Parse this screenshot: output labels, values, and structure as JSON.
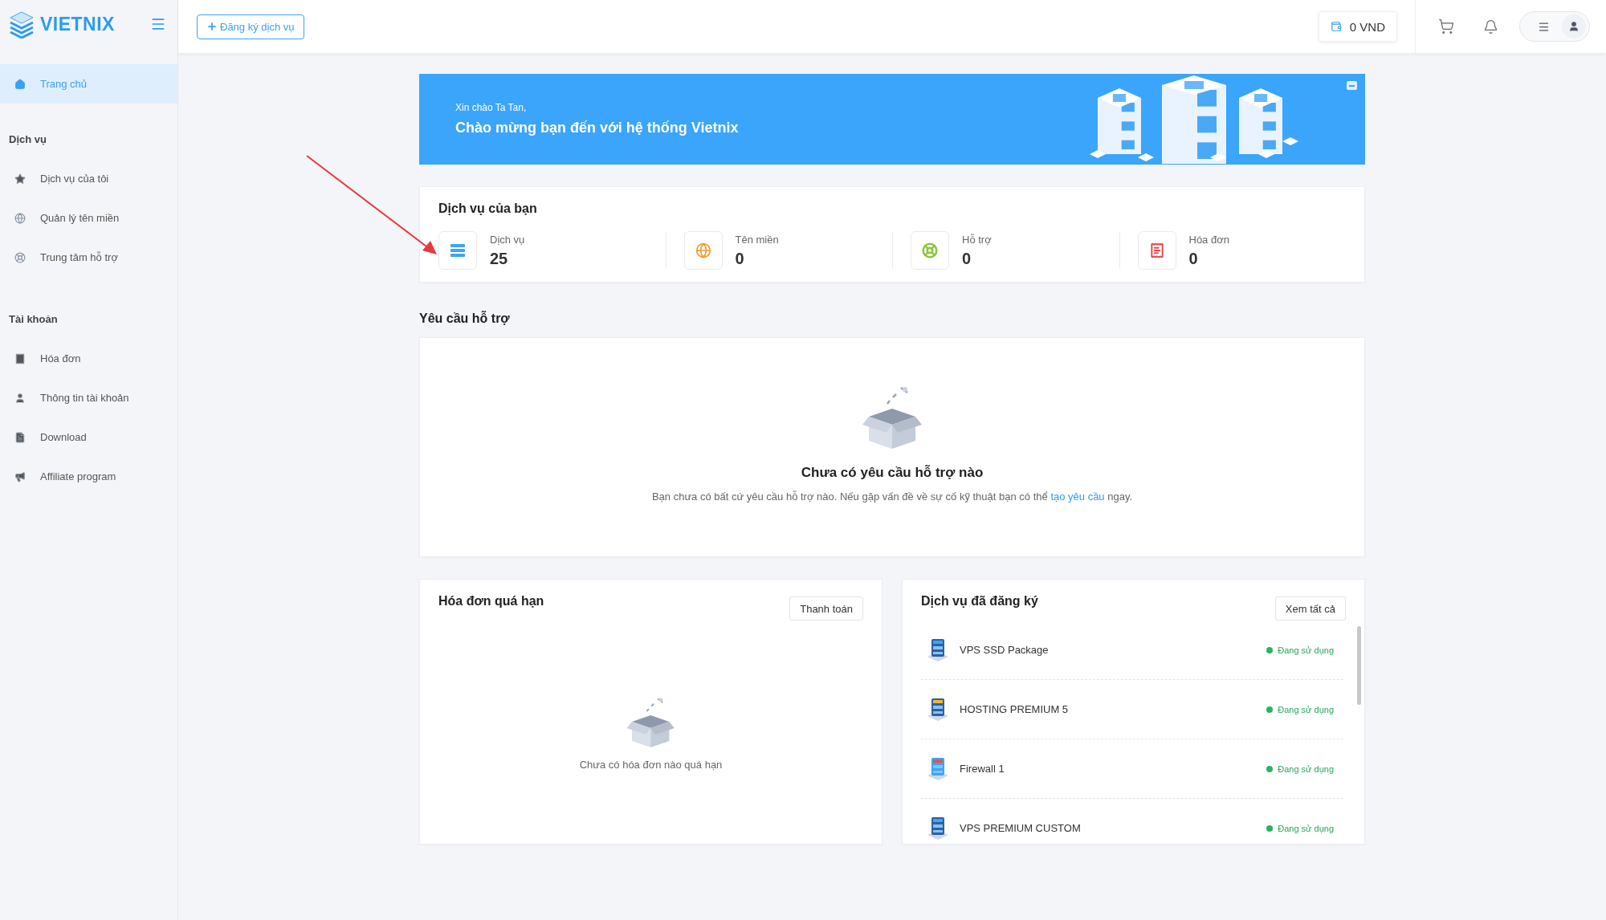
{
  "brand": {
    "name": "VIETNIX"
  },
  "sidebar": {
    "sections": [
      {
        "items": [
          {
            "label": "Trang chủ",
            "selected": true
          }
        ]
      },
      {
        "heading": "Dịch vụ",
        "items": [
          {
            "label": "Dịch vụ của tôi",
            "selected": false
          },
          {
            "label": "Quản lý tên miền",
            "selected": false
          },
          {
            "label": "Trung tâm hỗ trợ",
            "selected": false
          }
        ]
      },
      {
        "heading": "Tài khoản",
        "items": [
          {
            "label": "Hóa đơn",
            "selected": false
          },
          {
            "label": "Thông tin tài khoản",
            "selected": false
          },
          {
            "label": "Download",
            "selected": false
          },
          {
            "label": "Affiliate program",
            "selected": false
          }
        ]
      }
    ]
  },
  "topbar": {
    "register_button": "Đăng ký dịch vụ",
    "balance": "0 VND"
  },
  "banner": {
    "greeting": "Xin chào Ta Tan,",
    "title": "Chào mừng bạn đến với hệ thống Vietnix"
  },
  "services_summary": {
    "title": "Dịch vụ của bạn",
    "stats": [
      {
        "kind": "service",
        "label": "Dịch vụ",
        "value": "25"
      },
      {
        "kind": "domain",
        "label": "Tên miền",
        "value": "0"
      },
      {
        "kind": "support",
        "label": "Hỗ trợ",
        "value": "0"
      },
      {
        "kind": "invoice",
        "label": "Hóa đơn",
        "value": "0"
      }
    ]
  },
  "support_requests": {
    "title": "Yêu cầu hỗ trợ",
    "empty_title": "Chưa có yêu cầu hỗ trợ nào",
    "empty_text": "Bạn chưa có bất cứ yêu cầu hỗ trợ nào. Nếu gặp vấn đề về sự cố kỹ thuật bạn có thể",
    "link": "tạo yêu cầu",
    "empty_text_end": "ngay."
  },
  "overdue_invoices": {
    "title": "Hóa đơn quá hạn",
    "button": "Thanh toán",
    "empty_text": "Chưa có hóa đơn nào quá hạn"
  },
  "registered_services": {
    "title": "Dịch vụ đã đăng ký",
    "button": "Xem tất cả",
    "items": [
      {
        "kind": "vps",
        "name": "VPS SSD Package",
        "status": "Đang sử dụng",
        "color": "#28b463"
      },
      {
        "kind": "hosting",
        "name": "HOSTING PREMIUM 5",
        "status": "Đang sử dụng",
        "color": "#28b463"
      },
      {
        "kind": "firewall",
        "name": "Firewall 1",
        "status": "Đang sử dụng",
        "color": "#28b463"
      },
      {
        "kind": "vps",
        "name": "VPS PREMIUM CUSTOM",
        "status": "Đang sử dụng",
        "color": "#28b463"
      }
    ]
  }
}
